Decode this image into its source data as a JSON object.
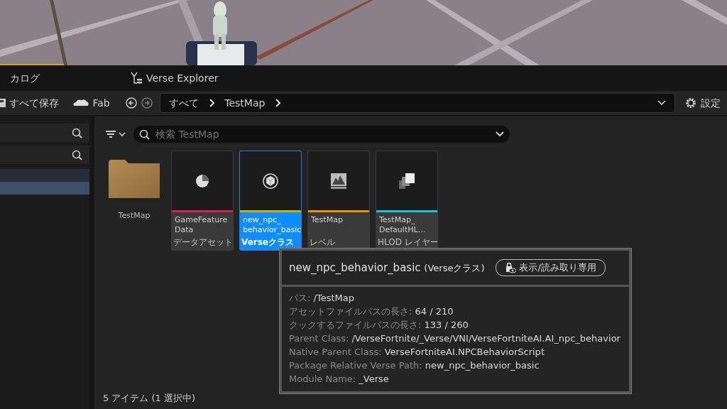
{
  "tabs": [
    {
      "label": "カログ",
      "selected": false
    },
    {
      "label": "Verse Explorer",
      "selected": false
    }
  ],
  "toolbar": {
    "save_all": "すべて保存",
    "fab": "Fab",
    "breadcrumb": [
      "すべて",
      "TestMap"
    ],
    "settings": "設定"
  },
  "sidebar": {
    "rows": [
      {
        "selected": false
      },
      {
        "selected": true
      }
    ]
  },
  "content": {
    "search": {
      "placeholder": "検索 TestMap"
    },
    "items": [
      {
        "kind": "folder",
        "name": "TestMap",
        "selected": false
      },
      {
        "kind": "data",
        "name": "GameFeature\nData",
        "type": "データアセット",
        "color": "#d61f5a",
        "selected": false
      },
      {
        "kind": "verse",
        "name": "new_npc_\nbehavior_basic",
        "type": "Verseクラス",
        "color": "#c8b400",
        "selected": true
      },
      {
        "kind": "level",
        "name": "TestMap",
        "type": "レベル",
        "color": "#f0900a",
        "selected": false
      },
      {
        "kind": "hlod",
        "name": "TestMap_\nDefaultHL…",
        "type": "HLOD レイヤー",
        "color": "#10c8d0",
        "selected": false
      }
    ]
  },
  "tooltip": {
    "title": "new_npc_behavior_basic",
    "type": "(Verseクラス)",
    "badge": "表示/読み取り専用",
    "properties": [
      {
        "label": "パス:",
        "value": "/TestMap"
      },
      {
        "label": "アセットファイルパスの長さ:",
        "value": "64 / 210"
      },
      {
        "label": "クックするファイルパスの長さ:",
        "value": "133 / 260"
      },
      {
        "label": "Parent Class:",
        "value": "/VerseFortnite/_Verse/VNI/VerseFortniteAI.AI_npc_behavior"
      },
      {
        "label": "Native Parent Class:",
        "value": "VerseFortniteAI.NPCBehaviorScript"
      },
      {
        "label": "Package Relative Verse Path:",
        "value": "new_npc_behavior_basic"
      },
      {
        "label": "Module Name:",
        "value": "_Verse"
      }
    ]
  },
  "status_bar": "5 アイテム (1 選択中)"
}
